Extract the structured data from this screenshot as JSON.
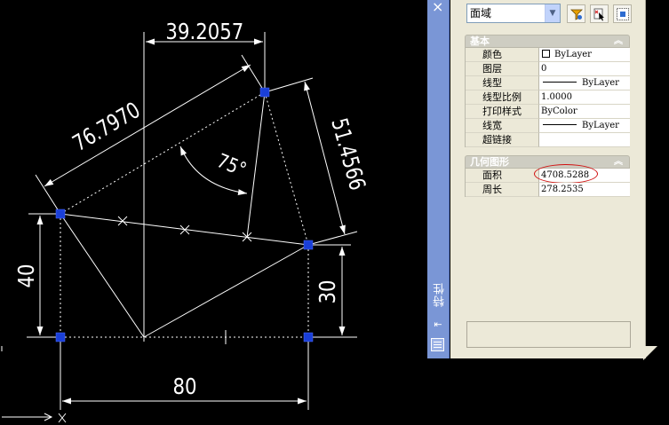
{
  "drawing": {
    "dims": {
      "top": "39.2057",
      "slant": "76.7970",
      "angle": "75°",
      "right_slant": "51.4566",
      "left": "40",
      "right": "30",
      "bottom": "80"
    }
  },
  "panel": {
    "title": "特性",
    "close": "×",
    "selector": {
      "value": "面域"
    },
    "toolbar": {
      "quick_select_icon": "quick-select-icon",
      "select_objects_icon": "select-objects-icon",
      "pickadd_icon": "pickadd-toggle-icon"
    },
    "sections": [
      {
        "title": "基本",
        "rows": [
          {
            "label": "颜色",
            "value": "ByLayer",
            "kind": "swatch"
          },
          {
            "label": "图层",
            "value": "0"
          },
          {
            "label": "线型",
            "value": "ByLayer",
            "kind": "line"
          },
          {
            "label": "线型比例",
            "value": "1.0000"
          },
          {
            "label": "打印样式",
            "value": "ByColor"
          },
          {
            "label": "线宽",
            "value": "ByLayer",
            "kind": "line"
          },
          {
            "label": "超链接",
            "value": ""
          }
        ]
      },
      {
        "title": "几何图形",
        "rows": [
          {
            "label": "面积",
            "value": "4708.5288"
          },
          {
            "label": "周长",
            "value": "278.2535"
          }
        ]
      }
    ],
    "colors": {
      "titlebar": "#7a96d6",
      "panel_bg": "#ece9d8",
      "highlight_circle": "#d01010",
      "grip": "#1a3fd8"
    }
  }
}
